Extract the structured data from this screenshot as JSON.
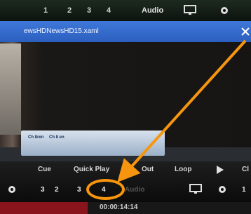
{
  "top": {
    "nums": [
      "1",
      "2",
      "3",
      "4"
    ],
    "audio_label": "Audio"
  },
  "window": {
    "title": "ewsHDNewsHD15.xaml"
  },
  "lower_third": {
    "name_a": "Ch 8ren",
    "name_b": "Ch 8 en"
  },
  "controls": {
    "labels": [
      "Cue",
      "Quick Play",
      "Out",
      "Loop",
      "Cl"
    ],
    "row_nums": [
      "3",
      "2",
      "3",
      "4"
    ],
    "audio_label": "Audio",
    "right_num": "1"
  },
  "bottom": {
    "text": "00:00:14:14"
  },
  "annotation": {
    "color": "#f7960e"
  }
}
